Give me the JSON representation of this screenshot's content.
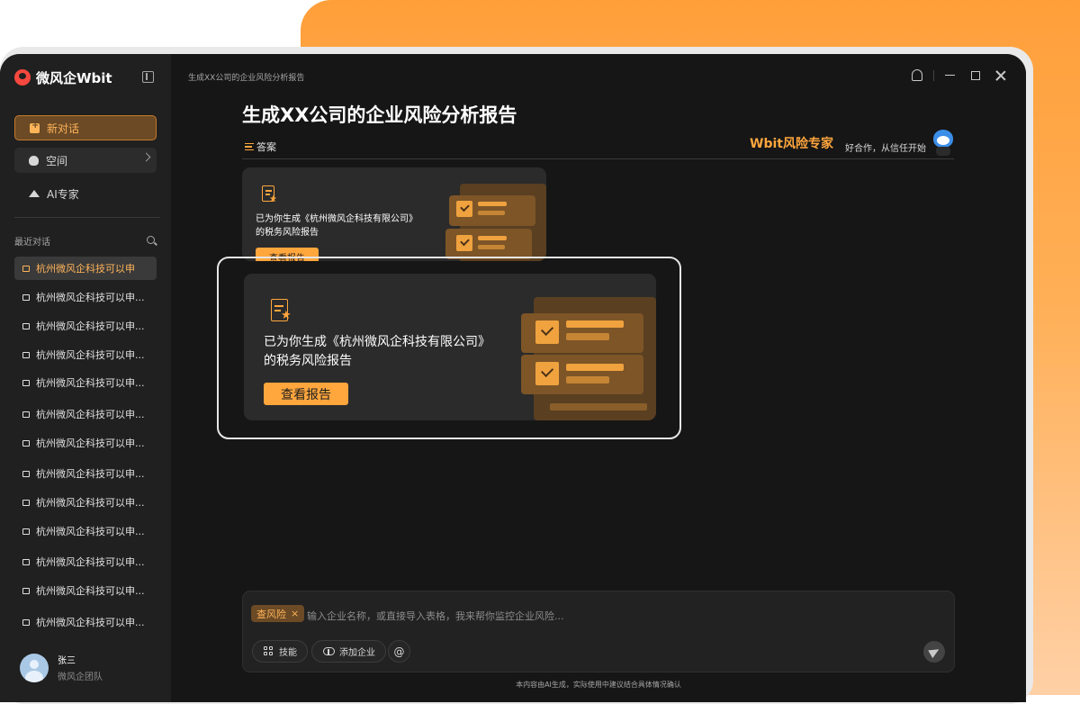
{
  "app": {
    "name": "微风企Wbit"
  },
  "sidebar": {
    "new_chat": "新对话",
    "space": "空间",
    "ai_expert": "AI专家",
    "recent_title": "最近对话",
    "conversations": [
      "杭州微风企科技可以申",
      "杭州微风企科技可以申...",
      "杭州微风企科技可以申...",
      "杭州微风企科技可以申...",
      "杭州微风企科技可以申...",
      "杭州微风企科技可以申...",
      "杭州微风企科技可以申...",
      "杭州微风企科技可以申...",
      "杭州微风企科技可以申...",
      "杭州微风企科技可以申...",
      "杭州微风企科技可以申...",
      "杭州微风企科技可以申...",
      "杭州微风企科技可以申..."
    ],
    "user": {
      "name": "张三",
      "team": "微风企团队"
    }
  },
  "header": {
    "breadcrumb": "生成XX公司的企业风险分析报告"
  },
  "chat": {
    "title": "生成XX公司的企业风险分析报告",
    "answer_label": "答案",
    "brand_tag": "Wbit风险专家",
    "brand_slogan": "好合作，从信任开始",
    "report_card": {
      "line1": "已为你生成《杭州微风企科技有限公司》",
      "line2": "的税务风险报告",
      "button": "查看报告"
    }
  },
  "composer": {
    "tag": "查风险",
    "placeholder": "输入企业名称，或直接导入表格，我来帮你监控企业风险...",
    "skills": "技能",
    "add_company": "添加企业",
    "mention": "@"
  },
  "footer": {
    "disclaimer": "本内容由AI生成，实际使用中建议结合具体情况确认"
  },
  "colors": {
    "accent": "#ffa63d",
    "sidebar_bg": "#202020",
    "main_bg": "#161616",
    "card_bg": "#2b2b2b"
  }
}
